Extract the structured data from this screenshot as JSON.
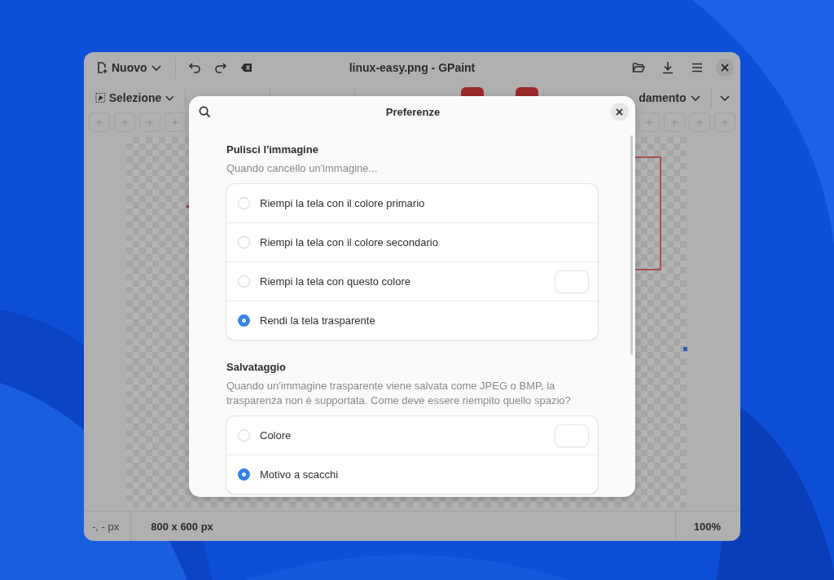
{
  "window": {
    "title": "linux-easy.png - GPaint",
    "new_button": "Nuovo"
  },
  "toolbar": {
    "tool_menu": "Selezione",
    "option_menu": "damento"
  },
  "status_bar": {
    "cursor": "-, - px",
    "size": "800 x 600 px",
    "zoom": "100%"
  },
  "dialog": {
    "title": "Preferenze",
    "sections": [
      {
        "heading": "Pulisci l'immagine",
        "description": "Quando cancello un'immagine...",
        "options": [
          {
            "label": "Riempi la tela con il colore primario",
            "selected": false,
            "kind": "radio"
          },
          {
            "label": "Riempi la tela con il colore secondario",
            "selected": false,
            "kind": "radio"
          },
          {
            "label": "Riempi la tela con questo colore",
            "selected": false,
            "kind": "radio_color"
          },
          {
            "label": "Rendi la tela trasparente",
            "selected": true,
            "kind": "radio"
          }
        ]
      },
      {
        "heading": "Salvataggio",
        "description": "Quando un'immagine trasparente viene salvata come JPEG o BMP, la trasparenza non è supportata. Come deve essere riempito quello spazio?",
        "options": [
          {
            "label": "Colore",
            "selected": false,
            "kind": "radio_color"
          },
          {
            "label": "Motivo a scacchi",
            "selected": true,
            "kind": "radio"
          }
        ]
      }
    ]
  }
}
